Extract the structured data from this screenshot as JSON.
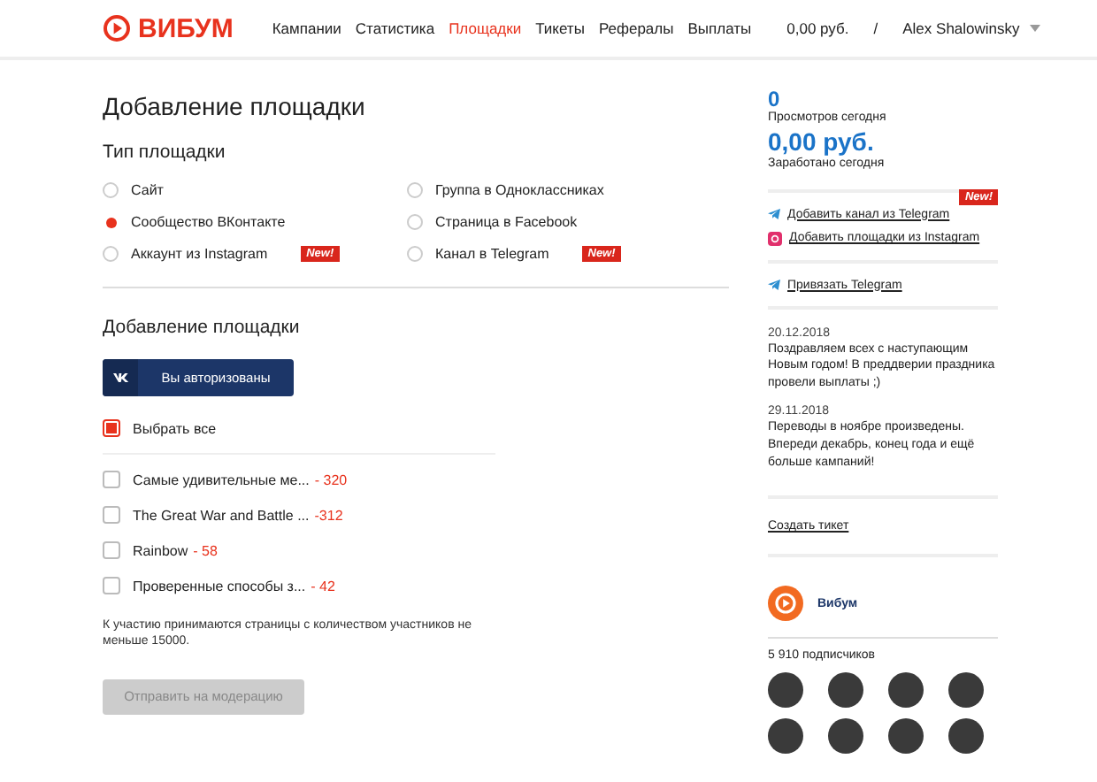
{
  "header": {
    "logo": "ВИБУМ",
    "nav": [
      {
        "label": "Кампании",
        "selected": false
      },
      {
        "label": "Статистика",
        "selected": false
      },
      {
        "label": "Площадки",
        "selected": true
      },
      {
        "label": "Тикеты",
        "selected": false
      },
      {
        "label": "Рефералы",
        "selected": false
      },
      {
        "label": "Выплаты",
        "selected": false
      }
    ],
    "balance": "0,00 руб.",
    "separator": "/",
    "user": "Alex Shalowinsky"
  },
  "main": {
    "title": "Добавление площадки",
    "type_heading": "Тип площадки",
    "types": [
      {
        "label": "Сайт",
        "selected": false
      },
      {
        "label": "Группа в Одноклассниках",
        "selected": false
      },
      {
        "label": "Сообщество ВКонтакте",
        "selected": true
      },
      {
        "label": "Страница в Facebook",
        "selected": false
      },
      {
        "label": "Аккаунт из Instagram",
        "selected": false,
        "badge": "New!"
      },
      {
        "label": "Канал в Telegram",
        "selected": false,
        "badge": "New!"
      }
    ],
    "add_heading": "Добавление площадки",
    "auth_button": "Вы авторизованы",
    "select_all": {
      "label": "Выбрать все",
      "checked": true
    },
    "pages": [
      {
        "name": "Самые удивительные ме...",
        "count": "- 320",
        "checked": false
      },
      {
        "name": "The Great War and Battle ...",
        "count": "-312",
        "checked": false
      },
      {
        "name": "Rainbow",
        "count": "- 58",
        "checked": false
      },
      {
        "name": "Проверенные способы з...",
        "count": "- 42",
        "checked": false
      }
    ],
    "note": "К участию принимаются страницы с количеством участников не меньше 15000.",
    "submit": {
      "label": "Отправить на модерацию",
      "disabled": true
    }
  },
  "sidebar": {
    "stats": [
      {
        "value": "0",
        "label": "Просмотров сегодня"
      },
      {
        "value": "0,00 руб.",
        "label": "Заработано сегодня"
      }
    ],
    "links": [
      {
        "kind": "telegram",
        "label": "Добавить канал из Telegram",
        "badge": "New!"
      },
      {
        "kind": "instagram",
        "label": "Добавить площадки из Instagram"
      }
    ],
    "bind_link": "Привязать Telegram",
    "news": [
      {
        "date": "20.12.2018",
        "text": "Поздравляем всех с наступающим Новым годом! В преддверии праздника провели выплаты ;)"
      },
      {
        "date": "29.11.2018",
        "text": "Переводы в ноябре произведены. Впереди декабрь, конец года и ещё больше кампаний!"
      }
    ],
    "ticket_link": "Создать тикет",
    "widget": {
      "name": "Вибум",
      "subscribers": "5 910 подписчиков"
    }
  }
}
